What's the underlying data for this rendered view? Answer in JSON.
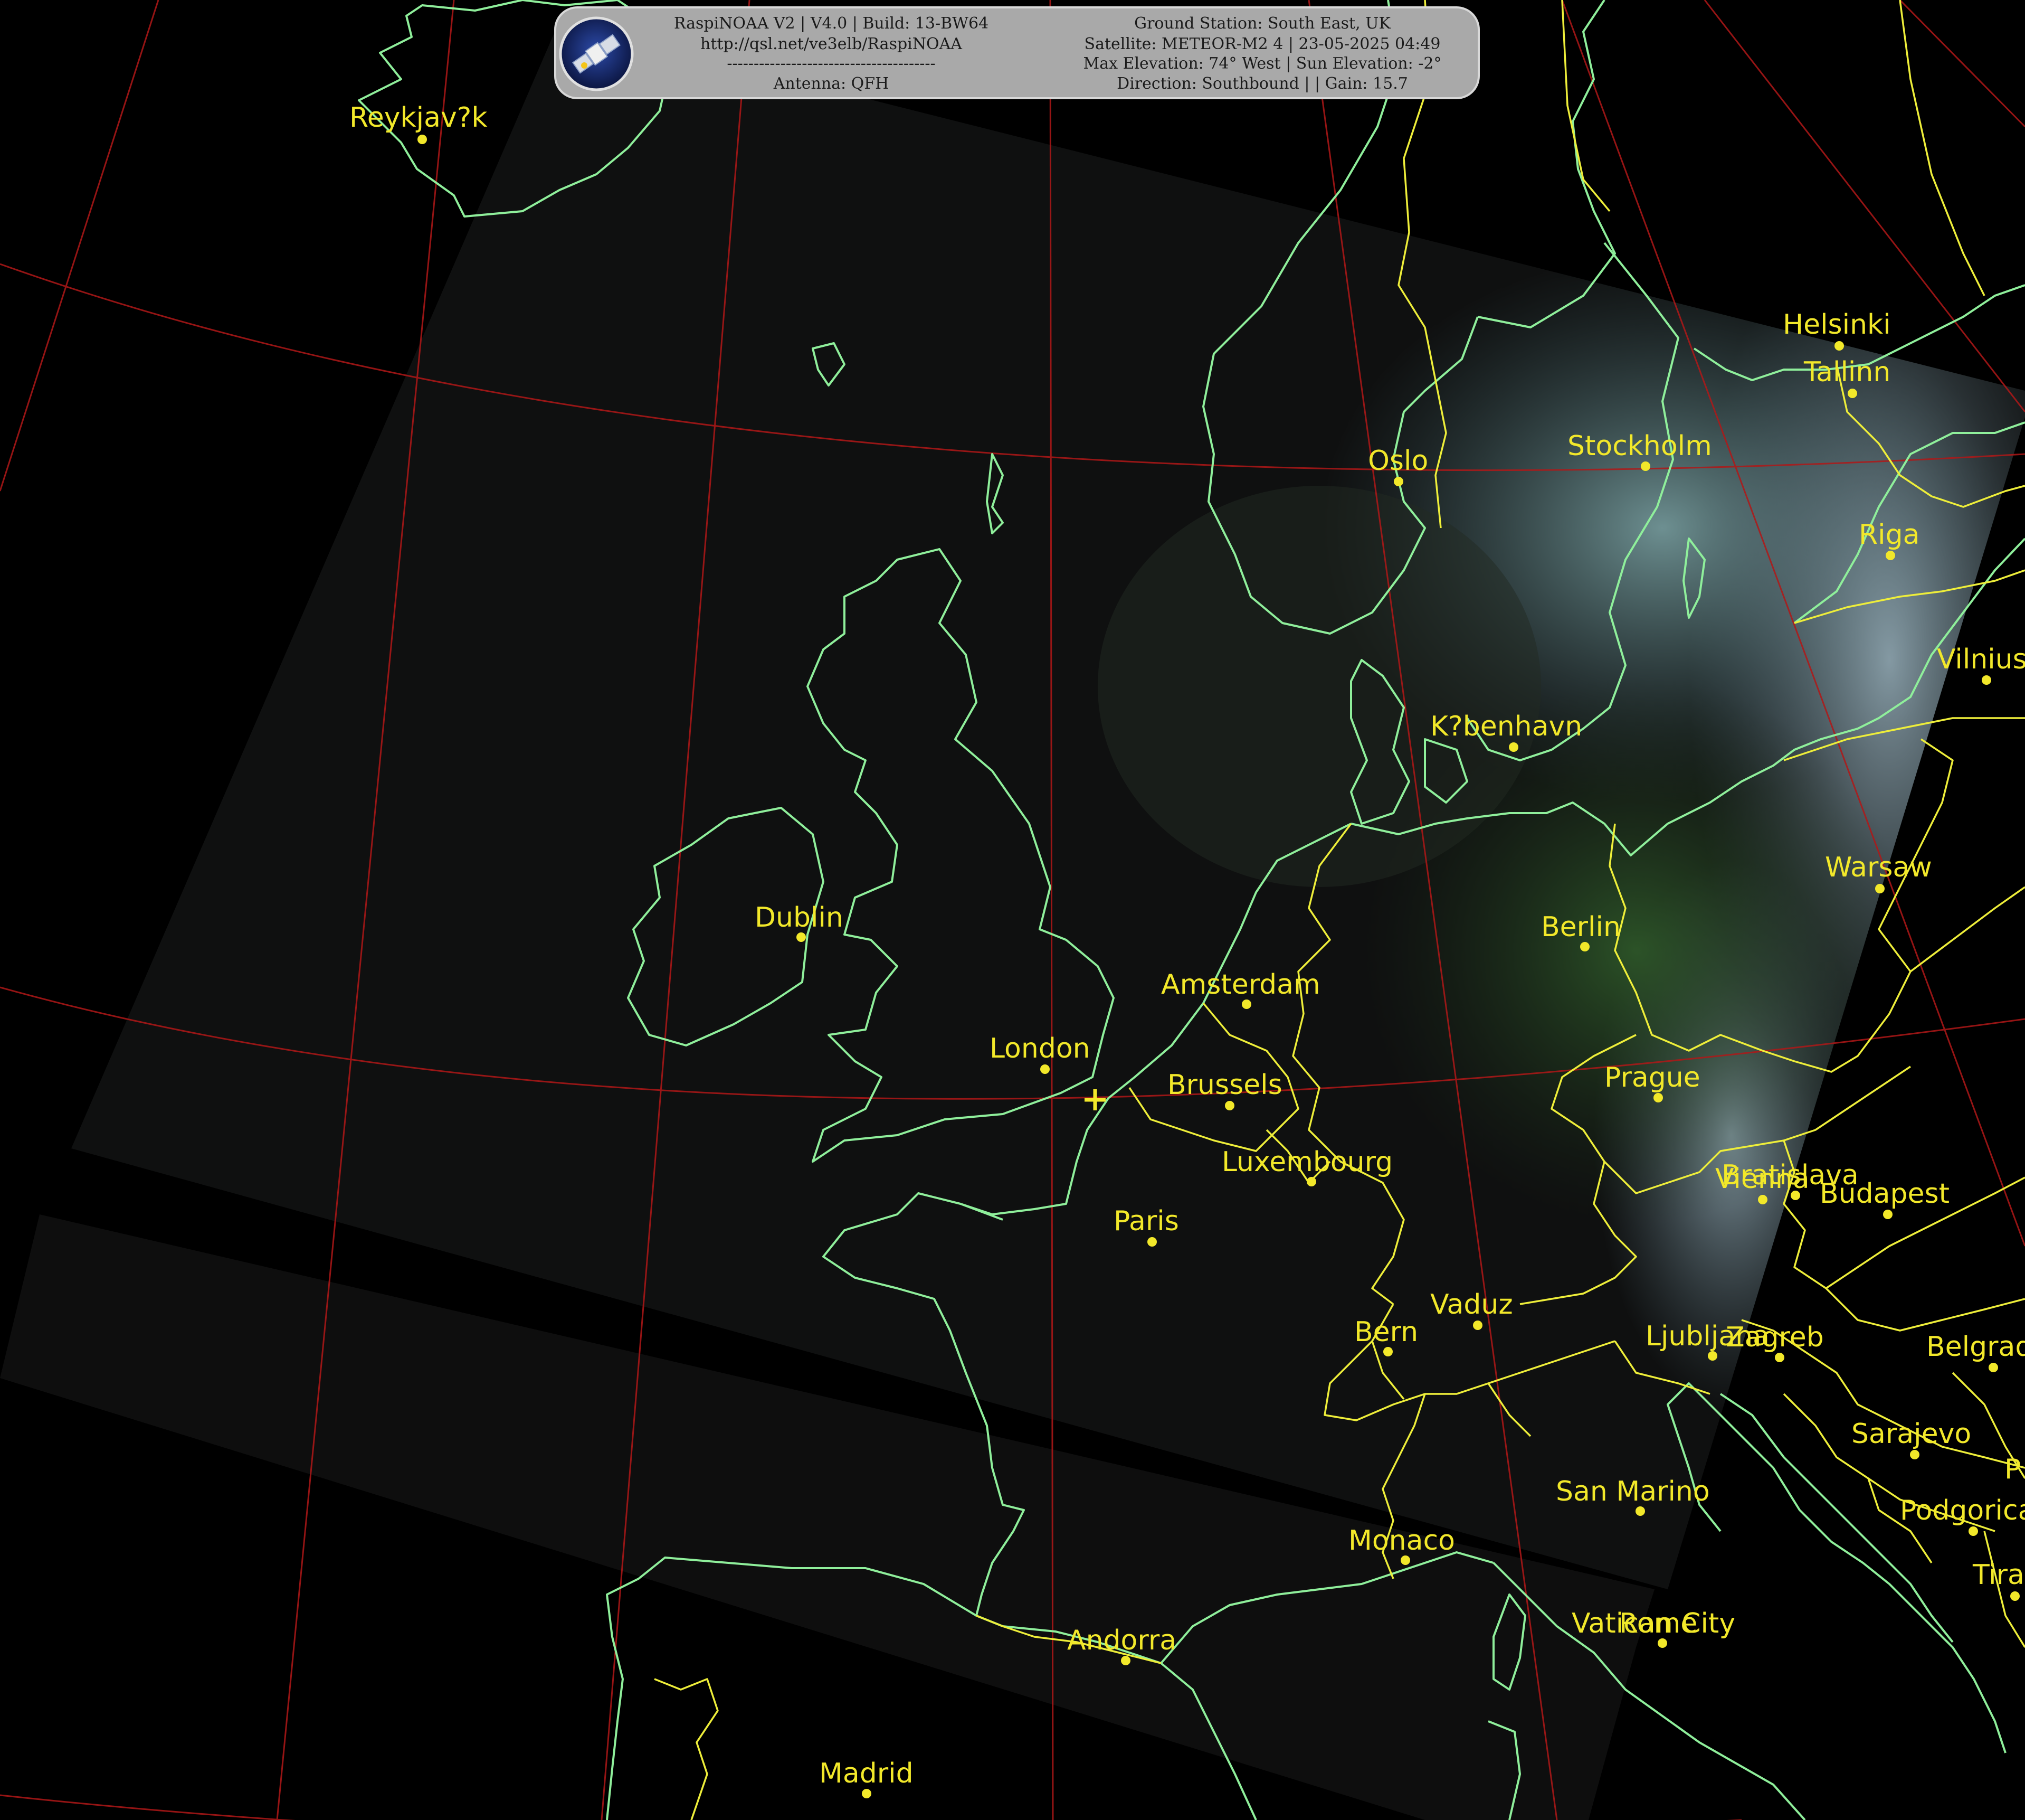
{
  "header": {
    "left_lines": [
      "RaspiNOAA V2 | V4.0 | Build: 13-BW64",
      "http://qsl.net/ve3elb/RaspiNOAA",
      "---------------------------------------",
      "Antenna: QFH"
    ],
    "right_lines": [
      "Ground Station: South East, UK",
      "Satellite: METEOR-M2 4 | 23-05-2025 04:49",
      "Max Elevation: 74° West | Sun Elevation: -2°",
      "Direction: Southbound | | Gain: 15.7"
    ],
    "logo_icon": "satellite-icon"
  },
  "colors": {
    "coastline": "#8fef9b",
    "border": "#eeee3a",
    "graticule": "#b01818",
    "label": "#f2e82a",
    "swath": "#111111"
  },
  "cities": [
    {
      "id": "reykjavik",
      "label": "Reykjav?k"
    },
    {
      "id": "helsinki",
      "label": "Helsinki"
    },
    {
      "id": "tallinn",
      "label": "Tallinn"
    },
    {
      "id": "oslo",
      "label": "Oslo"
    },
    {
      "id": "stockholm",
      "label": "Stockholm"
    },
    {
      "id": "riga",
      "label": "Riga"
    },
    {
      "id": "vilnius",
      "label": "Vilnius"
    },
    {
      "id": "kobenhavn",
      "label": "K?benhavn"
    },
    {
      "id": "dublin",
      "label": "Dublin"
    },
    {
      "id": "warsaw",
      "label": "Warsaw"
    },
    {
      "id": "berlin",
      "label": "Berlin"
    },
    {
      "id": "amsterdam",
      "label": "Amsterdam"
    },
    {
      "id": "london",
      "label": "London"
    },
    {
      "id": "brussels",
      "label": "Brussels"
    },
    {
      "id": "prague",
      "label": "Prague"
    },
    {
      "id": "luxembourg",
      "label": "Luxembourg"
    },
    {
      "id": "bratislava",
      "label": "Bratislava"
    },
    {
      "id": "vienna",
      "label": "Vienna"
    },
    {
      "id": "budapest",
      "label": "Budapest"
    },
    {
      "id": "paris",
      "label": "Paris"
    },
    {
      "id": "vaduz",
      "label": "Vaduz"
    },
    {
      "id": "bern",
      "label": "Bern"
    },
    {
      "id": "ljubljana",
      "label": "Ljubljana"
    },
    {
      "id": "zagreb",
      "label": "Zagreb"
    },
    {
      "id": "belgrade",
      "label": "Belgrade"
    },
    {
      "id": "sarajevo",
      "label": "Sarajevo"
    },
    {
      "id": "san-marino",
      "label": "San Marino"
    },
    {
      "id": "podgorica",
      "label": "Podgorica"
    },
    {
      "id": "monaco",
      "label": "Monaco"
    },
    {
      "id": "tirana",
      "label": "Tirana"
    },
    {
      "id": "vatican-city",
      "label": "Vatican City"
    },
    {
      "id": "rome",
      "label": "Rome"
    },
    {
      "id": "andorra",
      "label": "Andorra"
    },
    {
      "id": "madrid",
      "label": "Madrid"
    },
    {
      "id": "pristina",
      "label": "P"
    }
  ]
}
